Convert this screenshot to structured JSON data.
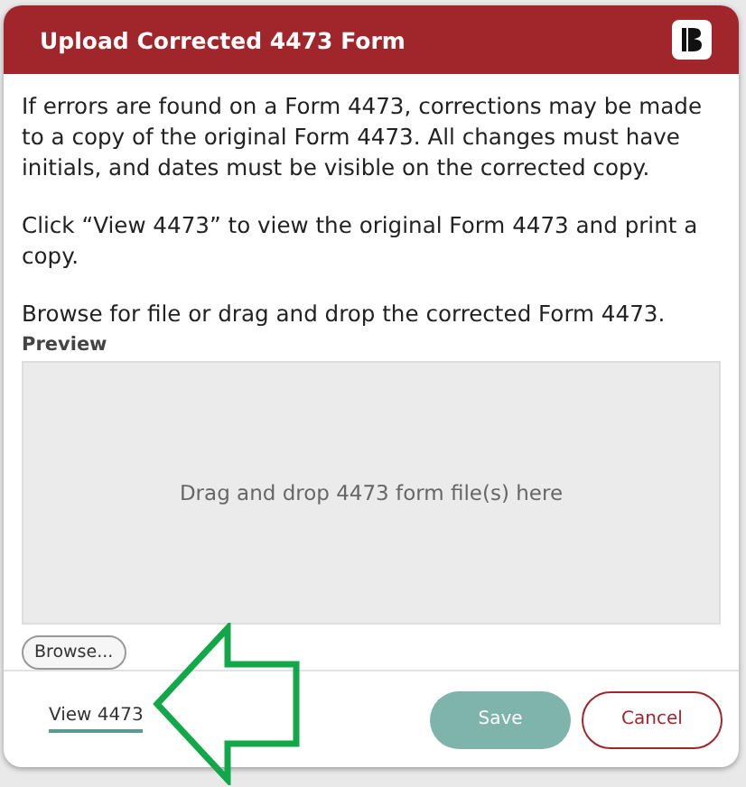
{
  "dialog": {
    "title": "Upload Corrected 4473 Form",
    "paragraphs": [
      "If errors are found on a Form 4473, corrections may be made to a copy of the original Form 4473. All changes must have initials, and dates must be visible on the corrected copy.",
      "Click “View 4473” to view the original Form 4473 and print a copy.",
      "Browse for file or drag and drop the corrected Form 4473."
    ],
    "preview_label": "Preview",
    "drop_zone": {
      "placeholder": "Drag and drop 4473 form file(s) here"
    },
    "browse_button": "Browse...",
    "view_link": "View 4473",
    "save_button": {
      "label": "Save",
      "disabled": true
    },
    "cancel_button": "Cancel"
  }
}
